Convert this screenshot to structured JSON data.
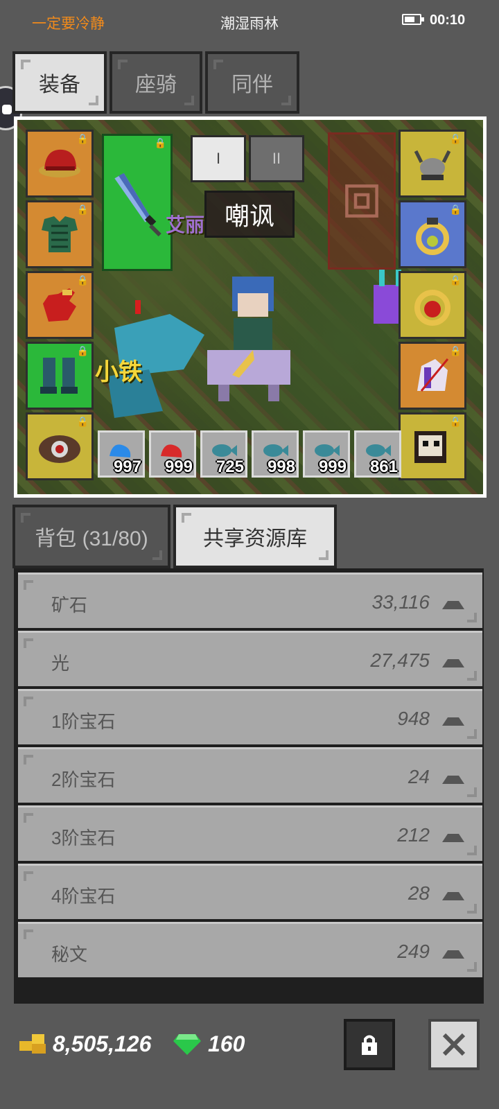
{
  "status_bar": {
    "motto": "一定要冷静",
    "zone": "潮湿雨林",
    "battery_level": 0.7,
    "time": "00:10"
  },
  "tabs": [
    {
      "label": "装备",
      "active": true
    },
    {
      "label": "座骑",
      "active": false
    },
    {
      "label": "同伴",
      "active": false
    }
  ],
  "equipment": {
    "left_slots": [
      {
        "item": "hat-icon",
        "color": "orange",
        "locked": true
      },
      {
        "item": "armor-icon",
        "color": "orange",
        "locked": true
      },
      {
        "item": "glove-icon",
        "color": "orange",
        "locked": true
      },
      {
        "item": "boots-icon",
        "color": "green",
        "locked": true
      },
      {
        "item": "relic-icon",
        "color": "yellow",
        "locked": true
      }
    ],
    "weapon": {
      "item": "sword-icon",
      "color": "green",
      "locked": true
    },
    "phase_buttons": [
      {
        "label": "I",
        "active": true
      },
      {
        "label": "II",
        "active": false
      }
    ],
    "skill_label": "嘲讽",
    "right_slots": [
      {
        "item": "helmet-icon",
        "color": "yellow",
        "locked": true
      },
      {
        "item": "ring-icon",
        "color": "blue",
        "locked": true
      },
      {
        "item": "amulet-icon",
        "color": "yellow",
        "locked": true
      },
      {
        "item": "mount-icon",
        "color": "orange",
        "locked": true
      },
      {
        "item": "pet-icon",
        "color": "yellow",
        "locked": true
      }
    ],
    "companion_names": [
      "艾丽",
      "小铁"
    ],
    "potions": [
      {
        "icon": "blue-potion-icon",
        "qty": "997"
      },
      {
        "icon": "red-potion-icon",
        "qty": "999"
      },
      {
        "icon": "fish-icon",
        "qty": "725"
      },
      {
        "icon": "fish-icon",
        "qty": "998"
      },
      {
        "icon": "fish-icon",
        "qty": "999"
      },
      {
        "icon": "fish-icon",
        "qty": "861"
      }
    ]
  },
  "inventory_tabs": [
    {
      "label": "背包 (31/80)",
      "active": false
    },
    {
      "label": "共享资源库",
      "active": true
    }
  ],
  "resources": [
    {
      "name": "矿石",
      "value": "33,116"
    },
    {
      "name": "光",
      "value": "27,475"
    },
    {
      "name": "1阶宝石",
      "value": "948"
    },
    {
      "name": "2阶宝石",
      "value": "24"
    },
    {
      "name": "3阶宝石",
      "value": "212"
    },
    {
      "name": "4阶宝石",
      "value": "28"
    },
    {
      "name": "秘文",
      "value": "249"
    }
  ],
  "footer": {
    "gold": "8,505,126",
    "gems": "160"
  },
  "colors": {
    "orange": "#d48a32",
    "green": "#2bb83a",
    "yellow": "#c8b53a",
    "blue": "#5a78cc",
    "motto": "#f08a1c"
  }
}
